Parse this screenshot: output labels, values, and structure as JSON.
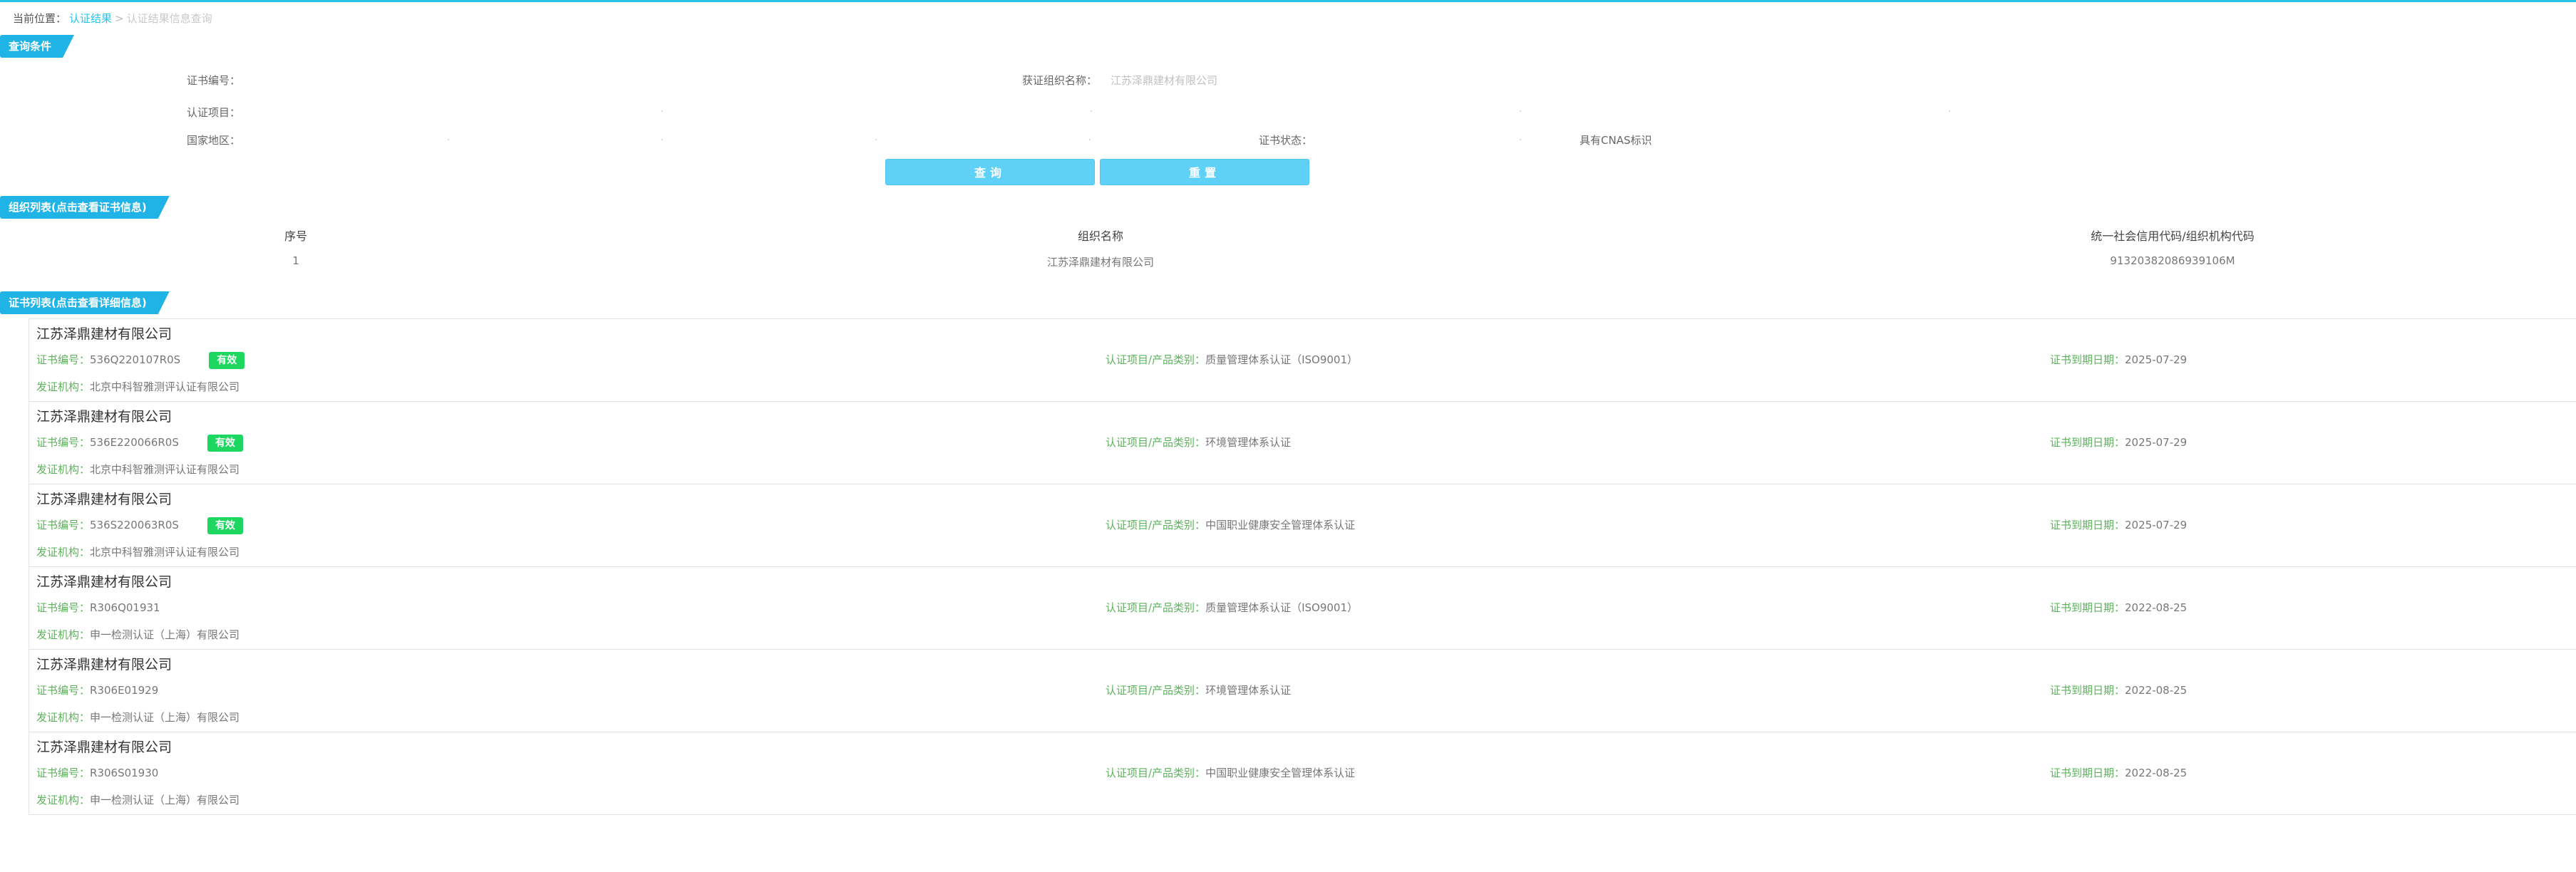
{
  "breadcrumb": {
    "current_label": "当前位置：",
    "link": "认证结果",
    "separator": ">",
    "last": "认证结果信息查询"
  },
  "query_section": {
    "title": "查询条件",
    "cert_no_label": "证书编号：",
    "org_name_label": "获证组织名称：",
    "org_name_value": "江苏泽鼎建材有限公司",
    "project_label": "认证项目：",
    "region_label": "国家地区：",
    "status_label": "证书状态：",
    "cnas_label": "具有CNAS标识",
    "search_button": "查询",
    "reset_button": "重置"
  },
  "org_section": {
    "title": "组织列表(点击查看证书信息)",
    "columns": [
      "序号",
      "组织名称",
      "统一社会信用代码/组织机构代码"
    ],
    "rows": [
      [
        "1",
        "江苏泽鼎建材有限公司",
        "91320382086939106M"
      ]
    ]
  },
  "cert_section": {
    "title": "证书列表(点击查看详细信息)",
    "no_label": "证书编号：",
    "project_label": "认证项目/产品类别：",
    "expiry_label": "证书到期日期：",
    "issuer_label": "发证机构：",
    "items": [
      {
        "org": "江苏泽鼎建材有限公司",
        "no": "536Q220107R0S",
        "status": "有效",
        "project": "质量管理体系认证（ISO9001）",
        "expiry": "2025-07-29",
        "issuer": "北京中科智雅测评认证有限公司"
      },
      {
        "org": "江苏泽鼎建材有限公司",
        "no": "536E220066R0S",
        "status": "有效",
        "project": "环境管理体系认证",
        "expiry": "2025-07-29",
        "issuer": "北京中科智雅测评认证有限公司"
      },
      {
        "org": "江苏泽鼎建材有限公司",
        "no": "536S220063R0S",
        "status": "有效",
        "project": "中国职业健康安全管理体系认证",
        "expiry": "2025-07-29",
        "issuer": "北京中科智雅测评认证有限公司"
      },
      {
        "org": "江苏泽鼎建材有限公司",
        "no": "R306Q01931",
        "status": "",
        "project": "质量管理体系认证（ISO9001）",
        "expiry": "2022-08-25",
        "issuer": "申一检测认证（上海）有限公司"
      },
      {
        "org": "江苏泽鼎建材有限公司",
        "no": "R306E01929",
        "status": "",
        "project": "环境管理体系认证",
        "expiry": "2022-08-25",
        "issuer": "申一检测认证（上海）有限公司"
      },
      {
        "org": "江苏泽鼎建材有限公司",
        "no": "R306S01930",
        "status": "",
        "project": "中国职业健康安全管理体系认证",
        "expiry": "2022-08-25",
        "issuer": "申一检测认证（上海）有限公司"
      }
    ]
  },
  "colors": {
    "accent": "#1fb3e6",
    "button": "#5fd1f7",
    "badge": "#1ed760",
    "label_green": "#5cb25c"
  }
}
